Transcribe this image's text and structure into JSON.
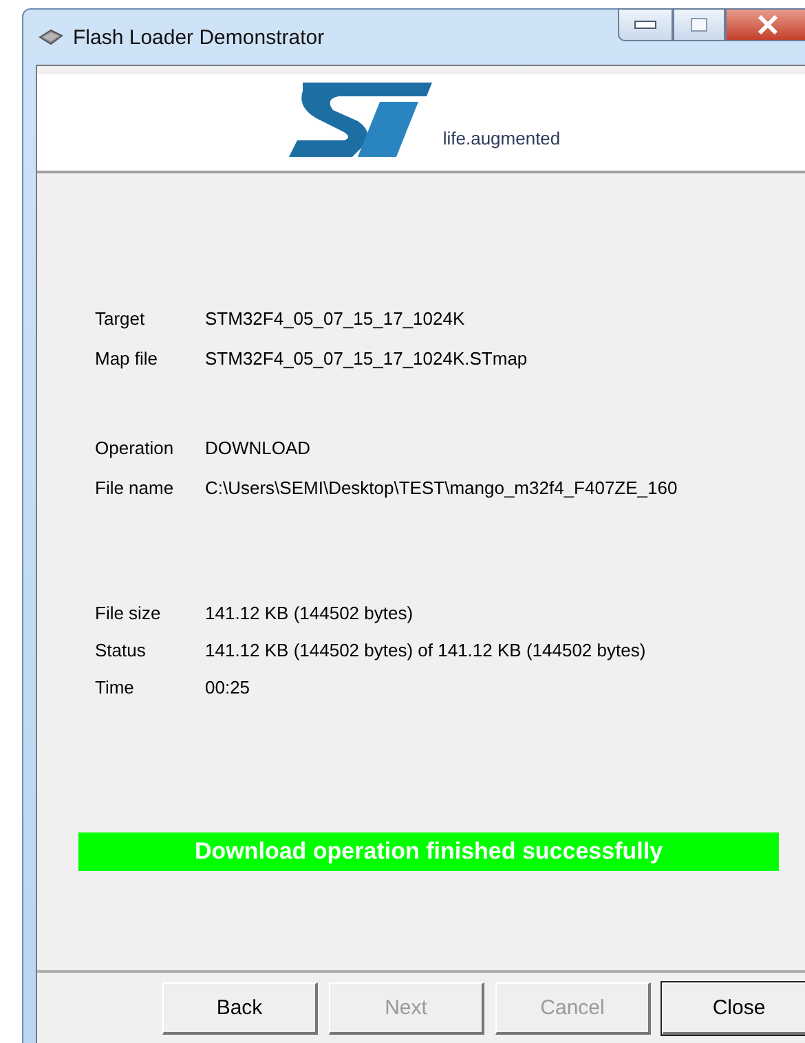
{
  "window": {
    "title": "Flash Loader Demonstrator"
  },
  "header": {
    "tagline": "life.augmented"
  },
  "info_groups": [
    [
      {
        "label": "Target",
        "value": "STM32F4_05_07_15_17_1024K"
      },
      {
        "label": "Map file",
        "value": "STM32F4_05_07_15_17_1024K.STmap"
      }
    ],
    [
      {
        "label": "Operation",
        "value": "DOWNLOAD"
      },
      {
        "label": "File name",
        "value": "C:\\Users\\SEMI\\Desktop\\TEST\\mango_m32f4_F407ZE_160"
      }
    ],
    [
      {
        "label": "File size",
        "value": "141.12 KB (144502 bytes)"
      },
      {
        "label": "Status",
        "value": "141.12 KB (144502 bytes) of 141.12 KB (144502 bytes)"
      },
      {
        "label": "Time",
        "value": "00:25"
      }
    ]
  ],
  "status_message": "Download operation finished successfully",
  "buttons": [
    {
      "label": "Back",
      "disabled": false,
      "default": false
    },
    {
      "label": "Next",
      "disabled": true,
      "default": false
    },
    {
      "label": "Cancel",
      "disabled": true,
      "default": false
    },
    {
      "label": "Close",
      "disabled": false,
      "default": true
    }
  ]
}
